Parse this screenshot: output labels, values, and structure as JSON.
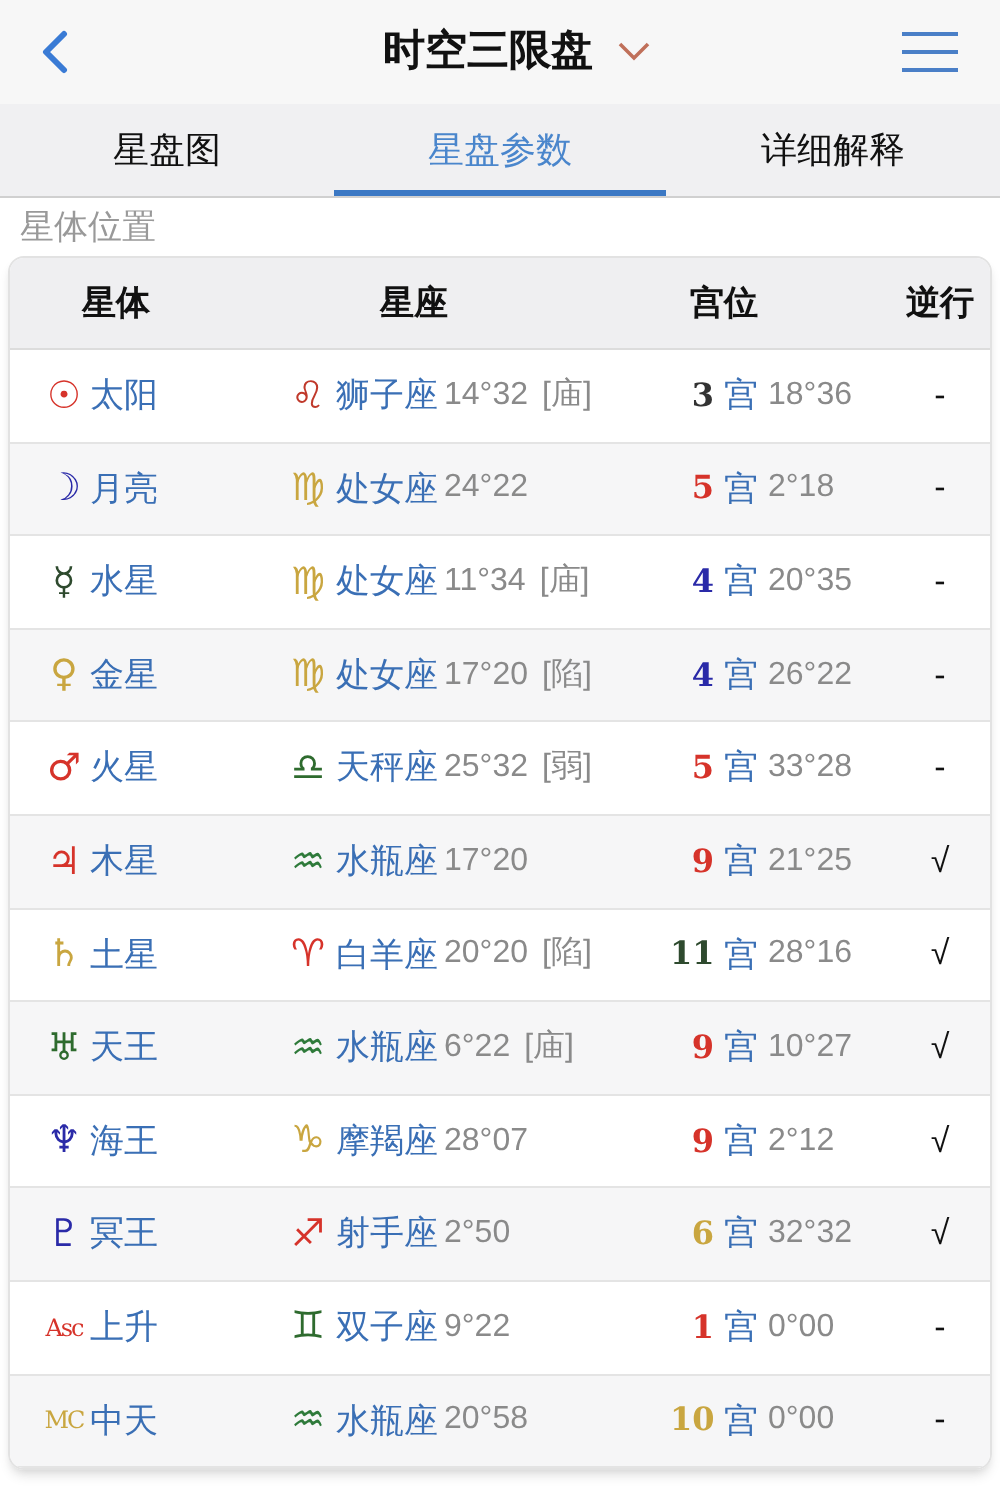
{
  "header": {
    "title": "时空三限盘"
  },
  "tabs": [
    {
      "label": "星盘图",
      "selected": false
    },
    {
      "label": "星盘参数",
      "selected": true
    },
    {
      "label": "详细解释",
      "selected": false
    }
  ],
  "section_title": "星体位置",
  "table": {
    "columns": [
      "星体",
      "星座",
      "宫位",
      "逆行"
    ],
    "rows": [
      {
        "body": {
          "symbol": "☉",
          "color": "#d6332a",
          "name": "太阳"
        },
        "sign": {
          "symbol": "♌",
          "color": "#c0392b",
          "name": "狮子座",
          "degree": "14°32",
          "dignity": "[庙]"
        },
        "house": {
          "number": "3",
          "color": "#333333",
          "label": "宫",
          "degree": "18°36"
        },
        "retrograde": "-"
      },
      {
        "body": {
          "symbol": "☽",
          "color": "#2a2aa8",
          "name": "月亮"
        },
        "sign": {
          "symbol": "♍",
          "color": "#c9a640",
          "name": "处女座",
          "degree": "24°22"
        },
        "house": {
          "number": "5",
          "color": "#d6332a",
          "label": "宫",
          "degree": "2°18"
        },
        "retrograde": "-"
      },
      {
        "body": {
          "symbol": "☿",
          "color": "#2e4a2e",
          "name": "水星"
        },
        "sign": {
          "symbol": "♍",
          "color": "#c9a640",
          "name": "处女座",
          "degree": "11°34",
          "dignity": "[庙]"
        },
        "house": {
          "number": "4",
          "color": "#2a2aa8",
          "label": "宫",
          "degree": "20°35"
        },
        "retrograde": "-"
      },
      {
        "body": {
          "symbol": "♀",
          "color": "#c9a640",
          "name": "金星"
        },
        "sign": {
          "symbol": "♍",
          "color": "#c9a640",
          "name": "处女座",
          "degree": "17°20",
          "dignity": "[陷]"
        },
        "house": {
          "number": "4",
          "color": "#2a2aa8",
          "label": "宫",
          "degree": "26°22"
        },
        "retrograde": "-"
      },
      {
        "body": {
          "symbol": "♂",
          "color": "#d6332a",
          "name": "火星"
        },
        "sign": {
          "symbol": "♎",
          "color": "#2e6b2e",
          "name": "天秤座",
          "degree": "25°32",
          "dignity": "[弱]"
        },
        "house": {
          "number": "5",
          "color": "#d6332a",
          "label": "宫",
          "degree": "33°28"
        },
        "retrograde": "-"
      },
      {
        "body": {
          "symbol": "♃",
          "color": "#d6332a",
          "name": "木星"
        },
        "sign": {
          "symbol": "♒",
          "color": "#2e7a3a",
          "name": "水瓶座",
          "degree": "17°20"
        },
        "house": {
          "number": "9",
          "color": "#d6332a",
          "label": "宫",
          "degree": "21°25"
        },
        "retrograde": "√"
      },
      {
        "body": {
          "symbol": "♄",
          "color": "#c9a640",
          "name": "土星"
        },
        "sign": {
          "symbol": "♈",
          "color": "#d6332a",
          "name": "白羊座",
          "degree": "20°20",
          "dignity": "[陷]"
        },
        "house": {
          "number": "11",
          "color": "#2e4a2e",
          "label": "宫",
          "degree": "28°16"
        },
        "retrograde": "√"
      },
      {
        "body": {
          "symbol": "♅",
          "color": "#2e6b2e",
          "name": "天王"
        },
        "sign": {
          "symbol": "♒",
          "color": "#2e7a3a",
          "name": "水瓶座",
          "degree": "6°22",
          "dignity": "[庙]"
        },
        "house": {
          "number": "9",
          "color": "#d6332a",
          "label": "宫",
          "degree": "10°27"
        },
        "retrograde": "√"
      },
      {
        "body": {
          "symbol": "♆",
          "color": "#2a2aa8",
          "name": "海王"
        },
        "sign": {
          "symbol": "♑",
          "color": "#c9a640",
          "name": "摩羯座",
          "degree": "28°07"
        },
        "house": {
          "number": "9",
          "color": "#d6332a",
          "label": "宫",
          "degree": "2°12"
        },
        "retrograde": "√"
      },
      {
        "body": {
          "symbol": "♇",
          "color": "#2a2aa8",
          "name": "冥王"
        },
        "sign": {
          "symbol": "♐",
          "color": "#d6332a",
          "name": "射手座",
          "degree": "2°50"
        },
        "house": {
          "number": "6",
          "color": "#c9a640",
          "label": "宫",
          "degree": "32°32"
        },
        "retrograde": "√"
      },
      {
        "body": {
          "symbol": "Asc",
          "color": "#d6332a",
          "name": "上升"
        },
        "sign": {
          "symbol": "♊",
          "color": "#2e6b2e",
          "name": "双子座",
          "degree": "9°22"
        },
        "house": {
          "number": "1",
          "color": "#d6332a",
          "label": "宫",
          "degree": "0°00"
        },
        "retrograde": "-"
      },
      {
        "body": {
          "symbol": "MC",
          "color": "#c9a640",
          "name": "中天"
        },
        "sign": {
          "symbol": "♒",
          "color": "#2e7a3a",
          "name": "水瓶座",
          "degree": "20°58"
        },
        "house": {
          "number": "10",
          "color": "#c9a640",
          "label": "宫",
          "degree": "0°00"
        },
        "retrograde": "-"
      }
    ]
  }
}
